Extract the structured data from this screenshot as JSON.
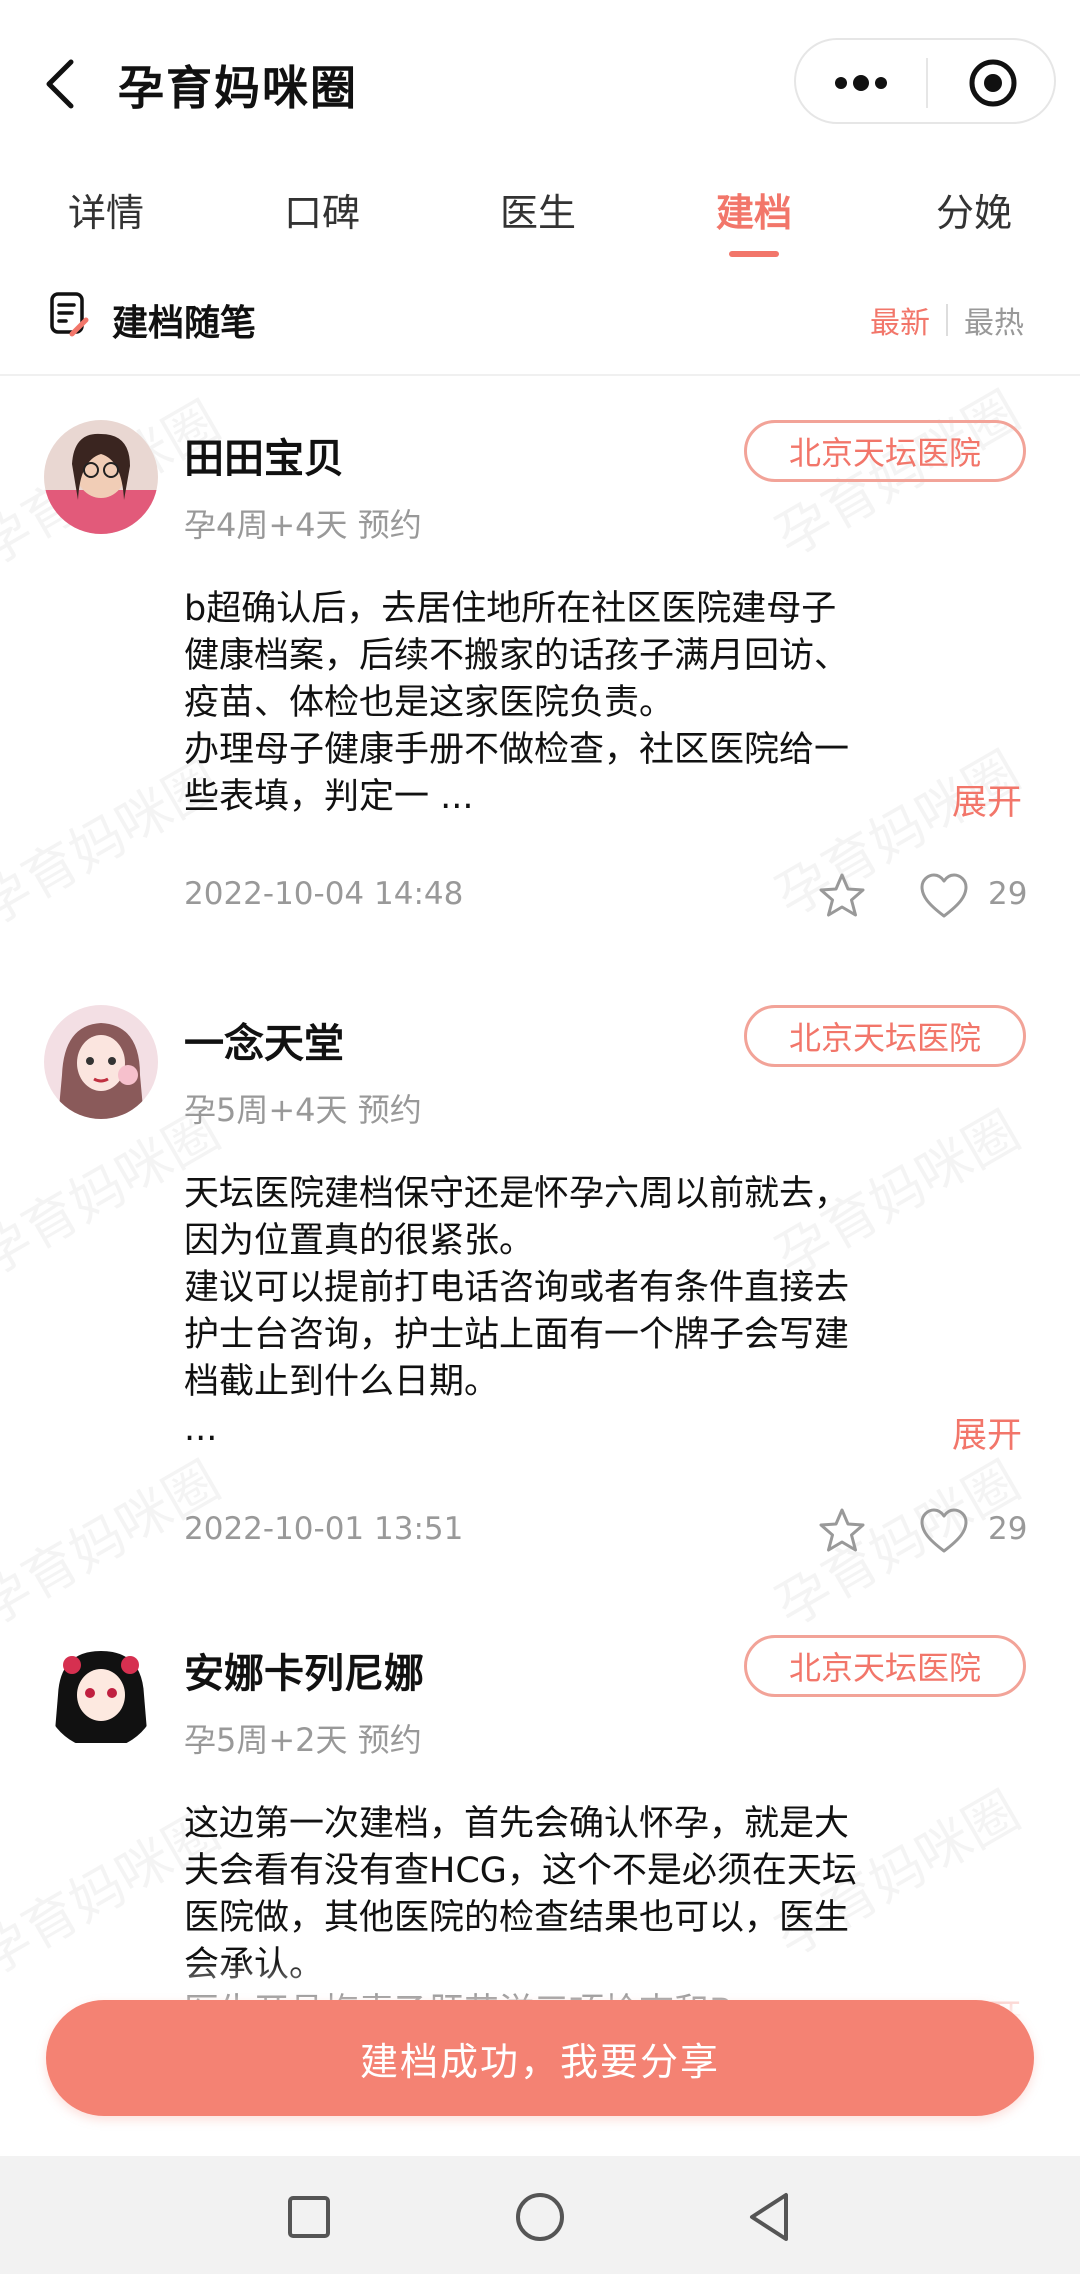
{
  "header": {
    "title": "孕育妈咪圈"
  },
  "tabs": [
    {
      "label": "详情"
    },
    {
      "label": "口碑"
    },
    {
      "label": "医生"
    },
    {
      "label": "建档"
    },
    {
      "label": "分娩"
    }
  ],
  "active_tab": "建档",
  "section": {
    "title": "建档随笔",
    "sort_new": "最新",
    "sort_hot": "最热"
  },
  "watermark_text": "孕育妈咪圈",
  "posts": [
    {
      "author": "田田宝贝",
      "meta": "孕4周+4天  预约",
      "hospital": "北京天坛医院",
      "text": "b超确认后，去居住地所在社区医院建母子\n健康档案，后续不搬家的话孩子满月回访、\n疫苗、体检也是这家医院负责。\n办理母子健康手册不做检查，社区医院给一\n些表填，判定一 ...",
      "expand": "展开",
      "date": "2022-10-04 14:48",
      "likes": "29"
    },
    {
      "author": "一念天堂",
      "meta": "孕5周+4天  预约",
      "hospital": "北京天坛医院",
      "text": "天坛医院建档保守还是怀孕六周以前就去，\n因为位置真的很紧张。\n建议可以提前打电话咨询或者有条件直接去\n护士台咨询，护士站上面有一个牌子会写建\n档截止到什么日期。\n...",
      "expand": "展开",
      "date": "2022-10-01 13:51",
      "likes": "29"
    },
    {
      "author": "安娜卡列尼娜",
      "meta": "孕5周+2天  预约",
      "hospital": "北京天坛医院",
      "text": "这边第一次建档，首先会确认怀孕，就是大\n夫会看有没有查HCG，这个不是必须在天坛\n医院做，其他医院的检查结果也可以，医生\n会承认。\n医生开具梅毒乙肝艾滋三项检查和B",
      "expand": "展开"
    }
  ],
  "cta": {
    "label": "建档成功，我要分享"
  },
  "colors": {
    "accent": "#f2766a",
    "cta_bg": "#f48273",
    "muted": "#999999"
  }
}
